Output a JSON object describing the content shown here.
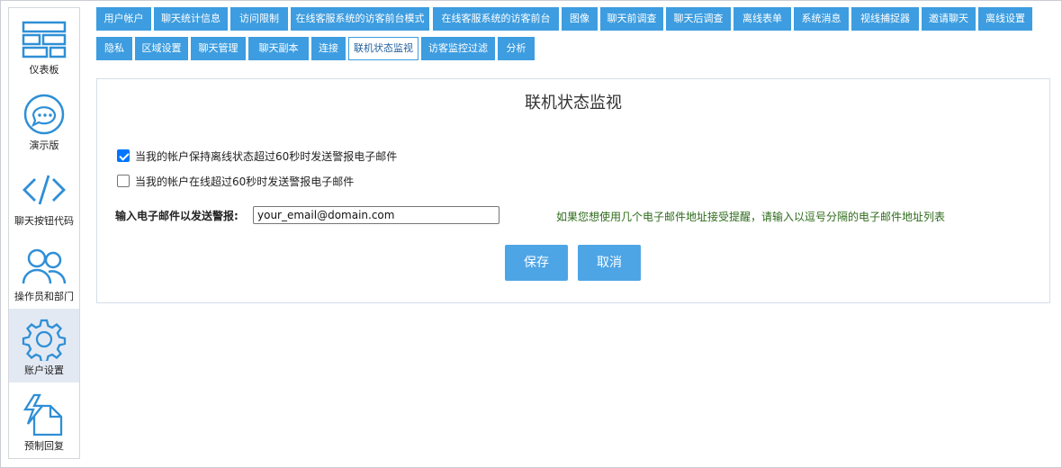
{
  "sidebar": {
    "items": [
      {
        "label": "仪表板",
        "icon": "dashboard-icon",
        "active": false
      },
      {
        "label": "演示版",
        "icon": "chat-bubble-icon",
        "active": false
      },
      {
        "label": "聊天按钮代码",
        "icon": "code-icon",
        "active": false
      },
      {
        "label": "操作员和部门",
        "icon": "users-icon",
        "active": false
      },
      {
        "label": "账户设置",
        "icon": "gear-icon",
        "active": true
      },
      {
        "label": "预制回复",
        "icon": "canned-reply-icon",
        "active": false
      }
    ]
  },
  "tabs": {
    "row1": [
      "用户帐户",
      "聊天统计信息",
      "访问限制",
      "在线客服系统的访客前台模式",
      "在线客服系统的访客前台",
      "图像",
      "聊天前调查",
      "聊天后调查",
      "离线表单",
      "系统消息",
      "视线捕捉器",
      "邀请聊天",
      "离线设置"
    ],
    "row2": [
      "隐私",
      "区域设置",
      "聊天管理",
      "聊天副本",
      "连接",
      "联机状态监视",
      "访客监控过滤",
      "分析"
    ],
    "active": "联机状态监视"
  },
  "panel": {
    "title": "联机状态监视",
    "checkbox1": {
      "label": "当我的帐户保持离线状态超过60秒时发送警报电子邮件",
      "checked": true
    },
    "checkbox2": {
      "label": "当我的帐户在线超过60秒时发送警报电子邮件",
      "checked": false
    },
    "email_label": "输入电子邮件以发送警报:",
    "email_value": "your_email@domain.com",
    "email_hint": "如果您想使用几个电子邮件地址接受提醒，请输入以逗号分隔的电子邮件地址列表",
    "save_label": "保存",
    "cancel_label": "取消"
  },
  "colors": {
    "tab_blue": "#3d9de0",
    "button_blue": "#4ea5e6",
    "hint_green": "#2e6b1b",
    "checkbox_blue": "#0075ff"
  }
}
